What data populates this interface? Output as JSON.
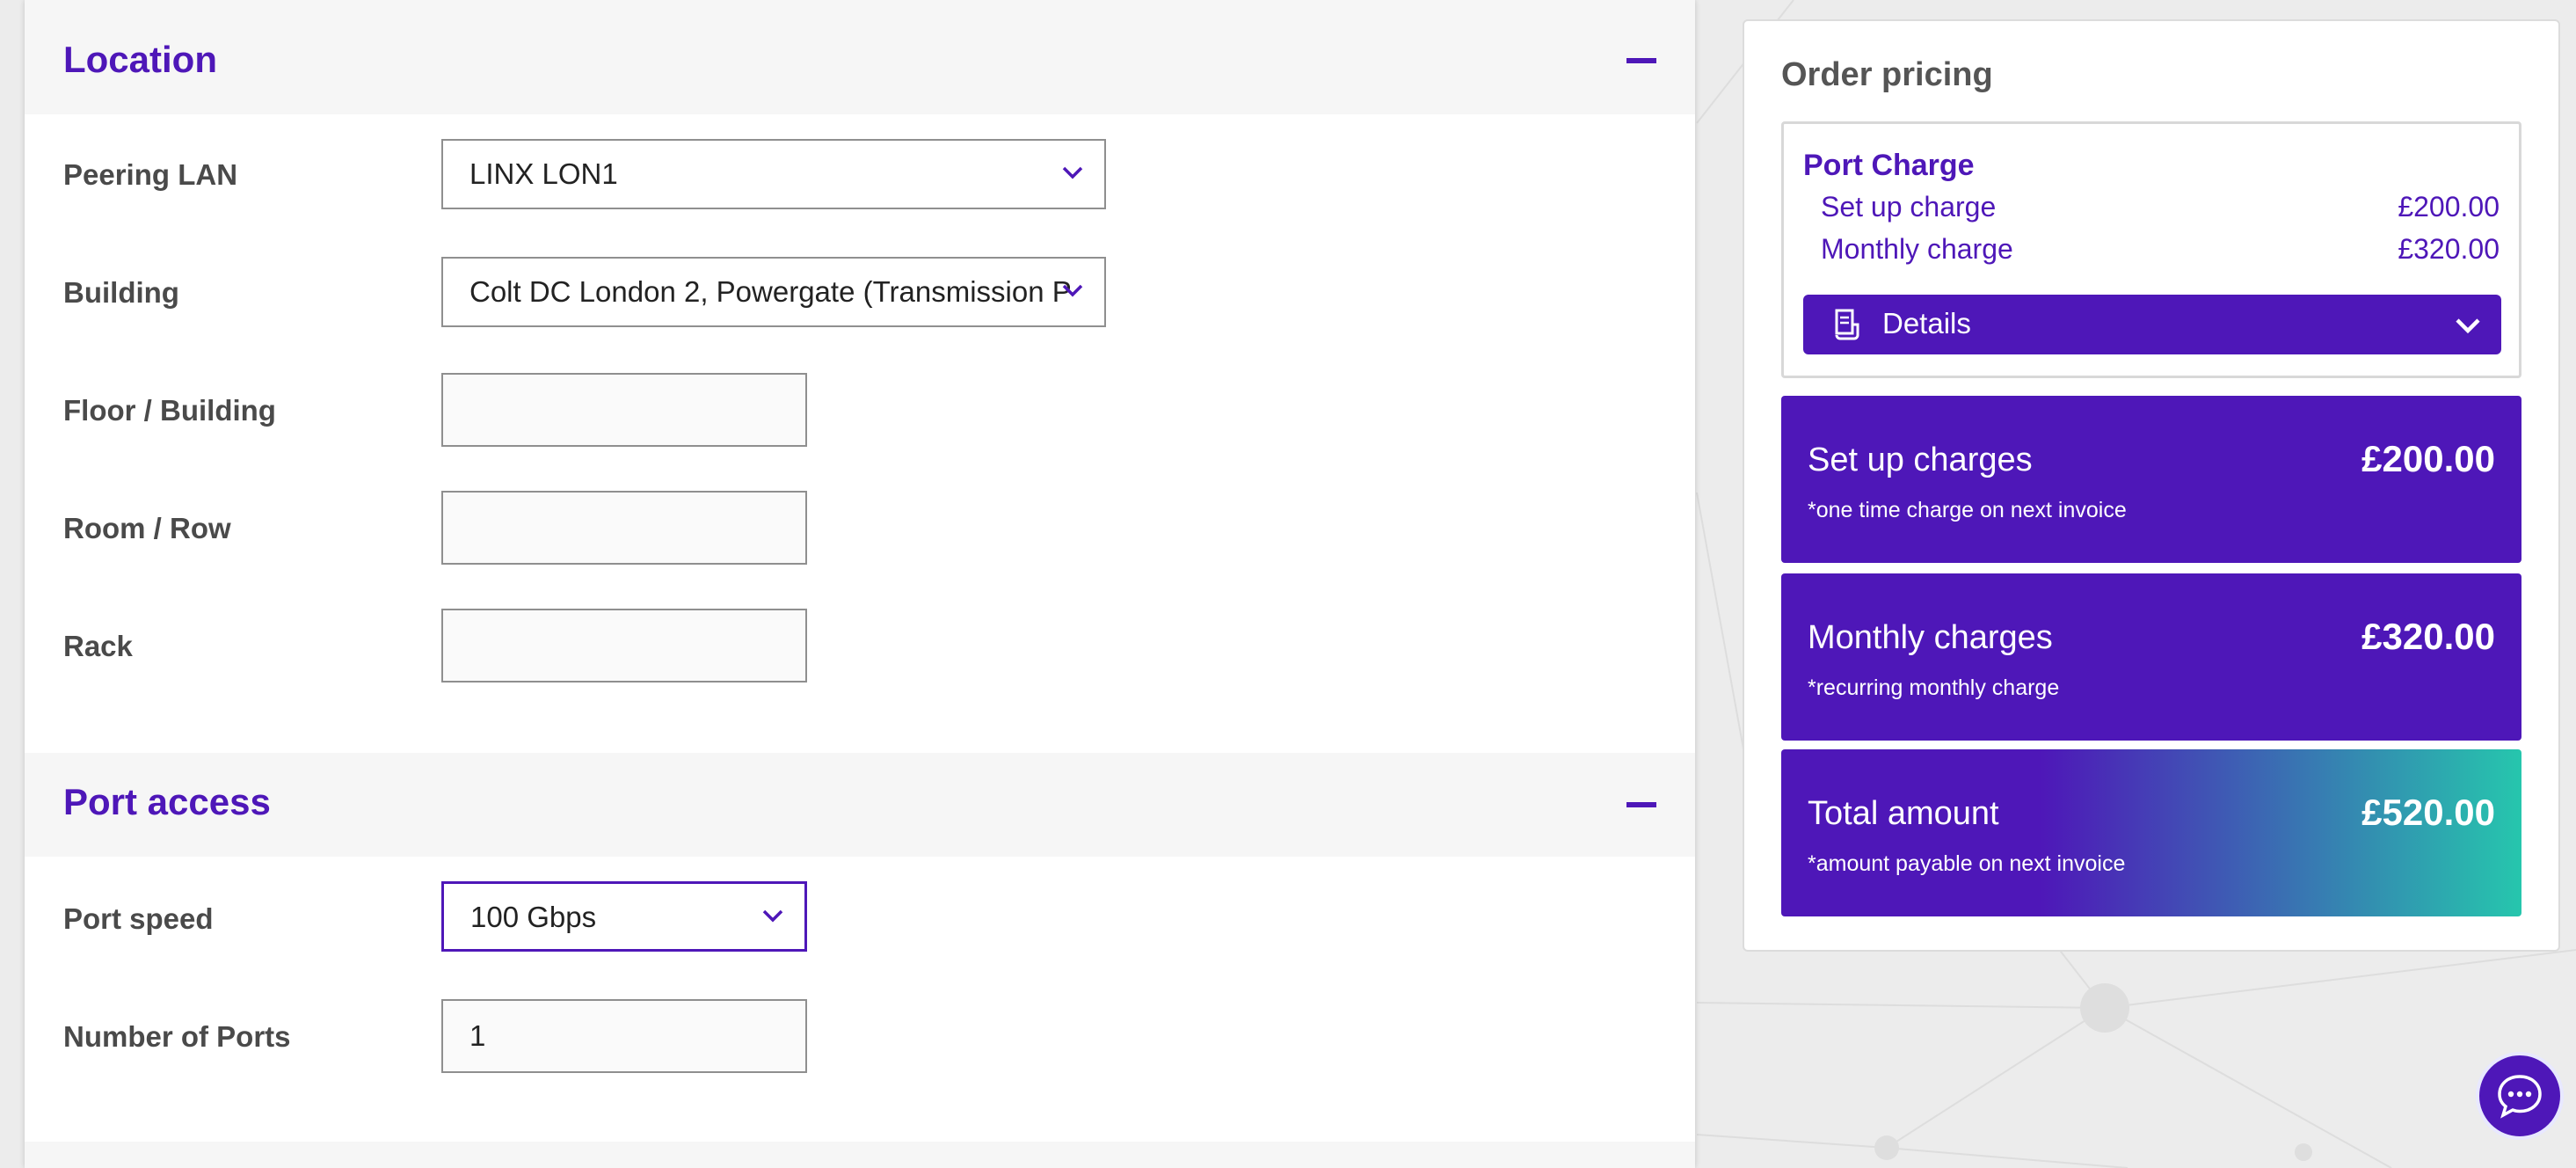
{
  "location": {
    "title": "Location",
    "fields": {
      "peering_lan": {
        "label": "Peering LAN",
        "value": "LINX LON1"
      },
      "building": {
        "label": "Building",
        "value": "Colt DC London 2, Powergate (Transmission P"
      },
      "floor": {
        "label": "Floor / Building",
        "value": ""
      },
      "room": {
        "label": "Room / Row",
        "value": ""
      },
      "rack": {
        "label": "Rack",
        "value": ""
      }
    }
  },
  "port_access": {
    "title": "Port access",
    "fields": {
      "port_speed": {
        "label": "Port speed",
        "value": "100 Gbps"
      },
      "num_ports": {
        "label": "Number of Ports",
        "value": "1"
      }
    }
  },
  "pricing": {
    "title": "Order pricing",
    "port_charge": {
      "title": "Port Charge",
      "setup_label": "Set up charge",
      "setup_amount": "£200.00",
      "monthly_label": "Monthly charge",
      "monthly_amount": "£320.00",
      "details_label": "Details"
    },
    "setup": {
      "label": "Set up charges",
      "amount": "£200.00",
      "note": "*one time charge on next invoice"
    },
    "monthly": {
      "label": "Monthly charges",
      "amount": "£320.00",
      "note": "*recurring monthly charge"
    },
    "total": {
      "label": "Total amount",
      "amount": "£520.00",
      "note": "*amount payable on next invoice"
    }
  },
  "colors": {
    "accent": "#4e17b8",
    "total_gradient_end": "#26c6ad",
    "label_text": "#4a4a4a"
  },
  "icons": {
    "collapse": "minus-icon",
    "dropdown": "chevron-down-icon",
    "details": "document-icon",
    "chat": "chat-bubble-icon"
  }
}
